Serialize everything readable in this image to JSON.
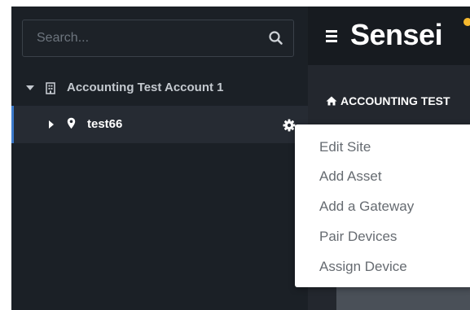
{
  "search": {
    "placeholder": "Search..."
  },
  "tree": {
    "account": {
      "label": "Accounting Test Account 1"
    },
    "site": {
      "label": "test66"
    }
  },
  "topbar": {
    "brand": "Sensei"
  },
  "breadcrumb": {
    "text": "ACCOUNTING TEST"
  },
  "context_menu": {
    "items": [
      "Edit Site",
      "Add Asset",
      "Add a Gateway",
      "Pair Devices",
      "Assign Device"
    ]
  },
  "colors": {
    "sidebar_bg": "#1b2026",
    "selected_row_bg": "#262b33",
    "selection_accent": "#3a78c9",
    "topbar_bg": "#171b20",
    "brand_dot": "#f5b82e",
    "menu_text": "#666b71"
  },
  "icons": [
    "search-icon",
    "caret-down-icon",
    "building-icon",
    "caret-right-icon",
    "map-pin-icon",
    "gear-icon",
    "hamburger-icon",
    "home-icon"
  ]
}
